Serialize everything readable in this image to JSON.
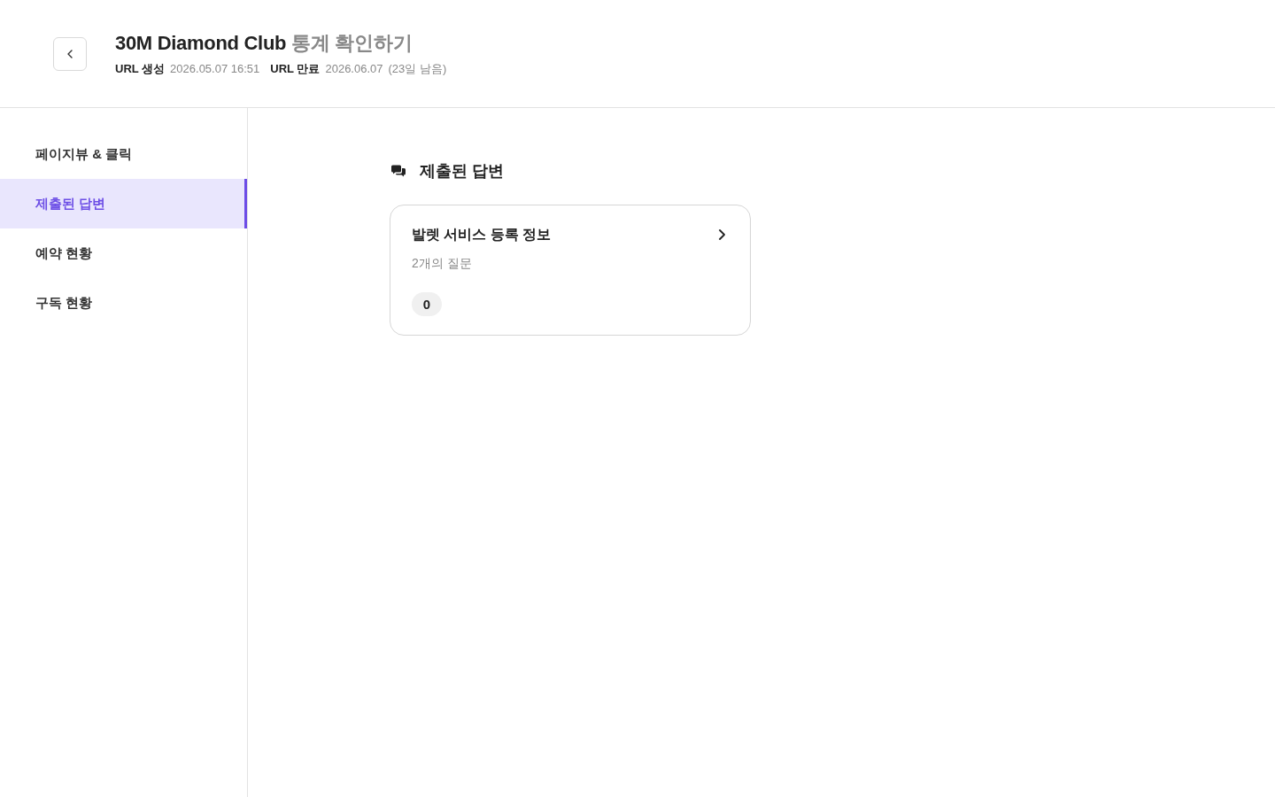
{
  "header": {
    "title": {
      "name": "30M Diamond Club",
      "suffix": "통계 확인하기"
    },
    "meta": [
      {
        "label": "URL 생성",
        "value": "2026.05.07 16:51"
      },
      {
        "label": "URL 만료",
        "value": "2026.06.07",
        "note": "(23일 남음)"
      }
    ]
  },
  "sidebar": {
    "items": [
      {
        "label": "페이지뷰 & 클릭",
        "selected": false
      },
      {
        "label": "제출된 답변",
        "selected": true
      },
      {
        "label": "예약 현황",
        "selected": false
      },
      {
        "label": "구독 현황",
        "selected": false
      }
    ]
  },
  "section": {
    "title": "제출된 답변",
    "cards": [
      {
        "title": "발렛 서비스 등록 정보",
        "subtitle": "2개의 질문",
        "count": "0"
      }
    ]
  }
}
